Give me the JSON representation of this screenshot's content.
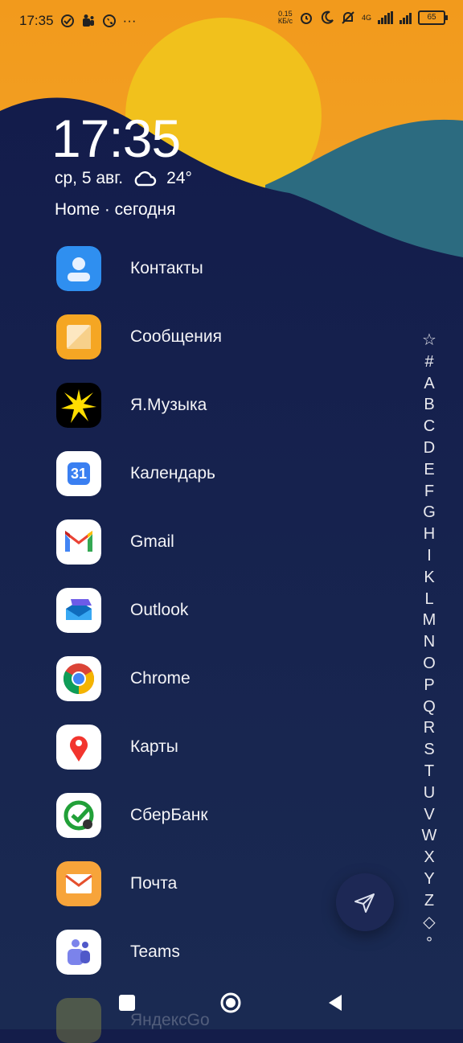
{
  "status_bar": {
    "time": "17:35",
    "speed_value": "0.15",
    "speed_unit": "КБ/с",
    "network": "4G",
    "battery": "65",
    "left_icons": [
      "check-circle-icon",
      "teams-notification-icon",
      "phone-icon",
      "more-icon"
    ],
    "right_icons": [
      "alarm-icon",
      "moon-icon",
      "mute-icon",
      "signal-icon",
      "wifi-signal-icon",
      "battery-icon"
    ]
  },
  "widget": {
    "clock": "17:35",
    "date": "ср, 5 авг.",
    "weather_icon": "cloud-icon",
    "temperature": "24°",
    "home_line": "Home · сегодня"
  },
  "apps": [
    {
      "label": "Контакты",
      "icon": "contacts-icon"
    },
    {
      "label": "Сообщения",
      "icon": "messages-icon"
    },
    {
      "label": "Я.Музыка",
      "icon": "yandex-music-icon"
    },
    {
      "label": "Календарь",
      "icon": "calendar-icon",
      "icon_text": "31"
    },
    {
      "label": "Gmail",
      "icon": "gmail-icon"
    },
    {
      "label": "Outlook",
      "icon": "outlook-icon"
    },
    {
      "label": "Chrome",
      "icon": "chrome-icon"
    },
    {
      "label": "Карты",
      "icon": "maps-icon"
    },
    {
      "label": "СберБанк",
      "icon": "sberbank-icon"
    },
    {
      "label": "Почта",
      "icon": "mail-icon"
    },
    {
      "label": "Teams",
      "icon": "teams-icon"
    }
  ],
  "partial_app": {
    "label": "ЯндексGo"
  },
  "alphabet_index": [
    "☆",
    "#",
    "A",
    "B",
    "C",
    "D",
    "E",
    "F",
    "G",
    "H",
    "I",
    "K",
    "L",
    "M",
    "N",
    "O",
    "P",
    "Q",
    "R",
    "S",
    "T",
    "U",
    "V",
    "W",
    "X",
    "Y",
    "Z",
    "◇",
    "°"
  ],
  "fab": {
    "icon": "send-icon"
  },
  "nav": {
    "recents": "square-icon",
    "home": "circle-icon",
    "back": "triangle-back-icon"
  },
  "colors": {
    "sky": "#f39c1e",
    "sun": "#f3c21a",
    "navy": "#141d4a",
    "teal": "#2b6a80"
  }
}
